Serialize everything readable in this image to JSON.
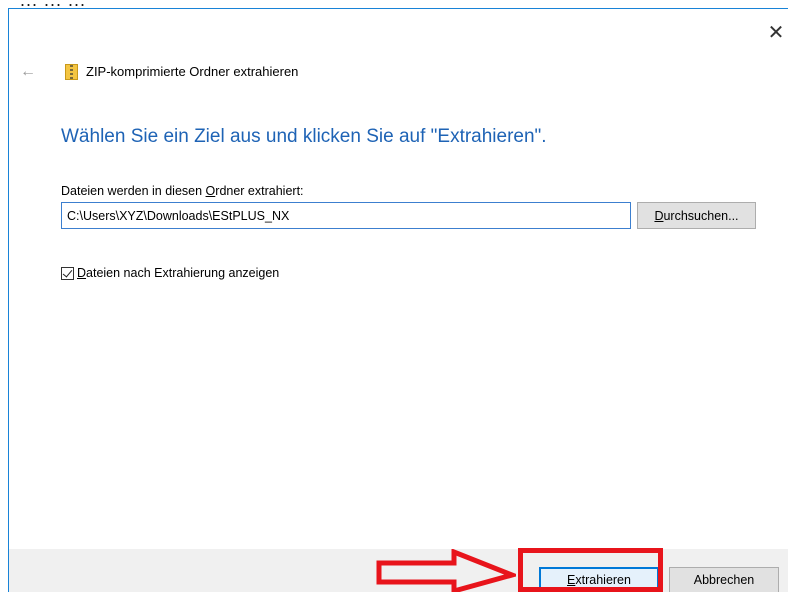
{
  "background": {
    "partial_text": "... ... ..."
  },
  "dialog": {
    "close_glyph": "✕",
    "back_glyph": "←",
    "title": "ZIP-komprimierte Ordner extrahieren",
    "heading": "Wählen Sie ein Ziel aus und klicken Sie auf \"Extrahieren\".",
    "path_label_pre": "Dateien werden in diesen ",
    "path_label_underline": "O",
    "path_label_post": "rdner extrahiert:",
    "path_value": "C:\\Users\\XYZ\\Downloads\\EStPLUS_NX",
    "browse_underline": "D",
    "browse_rest": "urchsuchen...",
    "checkbox_checked": true,
    "checkbox_underline": "D",
    "checkbox_rest": "ateien nach Extrahierung anzeigen",
    "extract_underline": "E",
    "extract_rest": "xtrahieren",
    "cancel_label": "Abbrechen"
  },
  "annotation": {
    "color": "#e8141b"
  },
  "colors": {
    "accent": "#1e63b5",
    "border_blue": "#1883d7",
    "footer_bg": "#f0f0f0"
  }
}
